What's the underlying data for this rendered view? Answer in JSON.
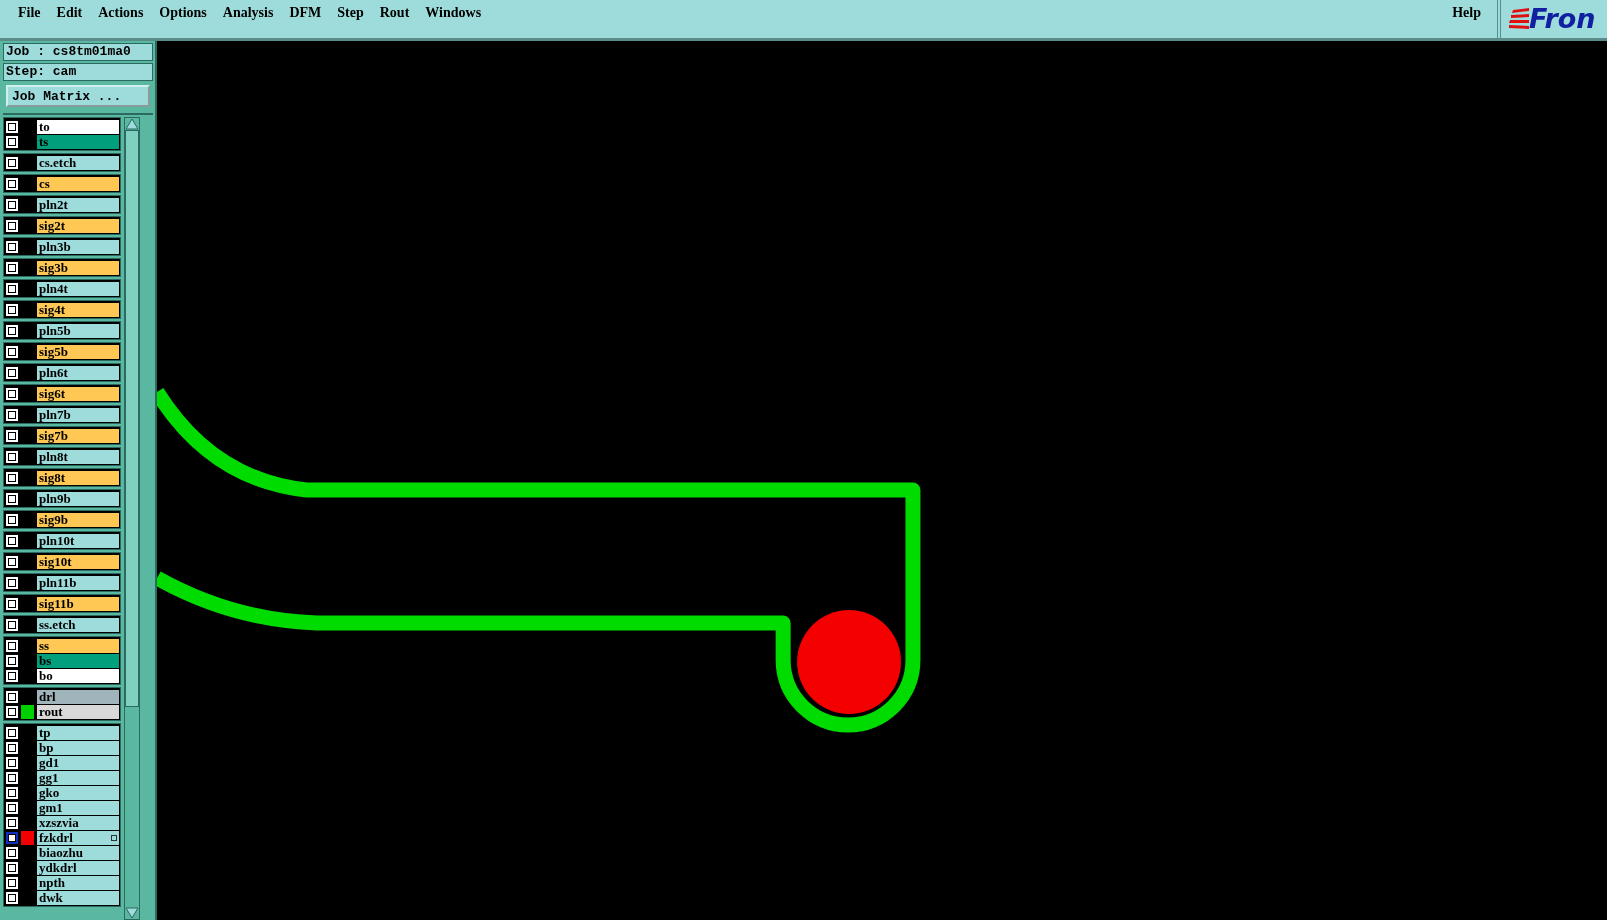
{
  "menu": [
    "File",
    "Edit",
    "Actions",
    "Options",
    "Analysis",
    "DFM",
    "Step",
    "Rout",
    "Windows"
  ],
  "help": "Help",
  "logo": "Fron",
  "job": "Job : cs8tm01ma0",
  "step": "Step: cam",
  "job_matrix_button": "Job Matrix ...",
  "layer_groups": [
    [
      {
        "name": "to",
        "color": "#ffffff",
        "selected": false
      },
      {
        "name": "ts",
        "color": "#00a07c",
        "selected": false
      }
    ],
    [
      {
        "name": "cs.etch",
        "color": "#9edcdc",
        "selected": false
      }
    ],
    [
      {
        "name": "cs",
        "color": "#ffc854",
        "selected": false
      }
    ],
    [
      {
        "name": "pln2t",
        "color": "#9edcdc",
        "selected": false
      }
    ],
    [
      {
        "name": "sig2t",
        "color": "#ffc854",
        "selected": false
      }
    ],
    [
      {
        "name": "pln3b",
        "color": "#9edcdc",
        "selected": false
      }
    ],
    [
      {
        "name": "sig3b",
        "color": "#ffc854",
        "selected": false
      }
    ],
    [
      {
        "name": "pln4t",
        "color": "#9edcdc",
        "selected": false
      }
    ],
    [
      {
        "name": "sig4t",
        "color": "#ffc854",
        "selected": false
      }
    ],
    [
      {
        "name": "pln5b",
        "color": "#9edcdc",
        "selected": false
      }
    ],
    [
      {
        "name": "sig5b",
        "color": "#ffc854",
        "selected": false
      }
    ],
    [
      {
        "name": "pln6t",
        "color": "#9edcdc",
        "selected": false
      }
    ],
    [
      {
        "name": "sig6t",
        "color": "#ffc854",
        "selected": false
      }
    ],
    [
      {
        "name": "pln7b",
        "color": "#9edcdc",
        "selected": false
      }
    ],
    [
      {
        "name": "sig7b",
        "color": "#ffc854",
        "selected": false
      }
    ],
    [
      {
        "name": "pln8t",
        "color": "#9edcdc",
        "selected": false
      }
    ],
    [
      {
        "name": "sig8t",
        "color": "#ffc854",
        "selected": false
      }
    ],
    [
      {
        "name": "pln9b",
        "color": "#9edcdc",
        "selected": false
      }
    ],
    [
      {
        "name": "sig9b",
        "color": "#ffc854",
        "selected": false
      }
    ],
    [
      {
        "name": "pln10t",
        "color": "#9edcdc",
        "selected": false
      }
    ],
    [
      {
        "name": "sig10t",
        "color": "#ffc854",
        "selected": false
      }
    ],
    [
      {
        "name": "pln11b",
        "color": "#9edcdc",
        "selected": false
      }
    ],
    [
      {
        "name": "sig11b",
        "color": "#ffc854",
        "selected": false
      }
    ],
    [
      {
        "name": "ss.etch",
        "color": "#9edcdc",
        "selected": false
      }
    ],
    [
      {
        "name": "ss",
        "color": "#ffc854",
        "selected": false
      },
      {
        "name": "bs",
        "color": "#00a07c",
        "selected": false
      },
      {
        "name": "bo",
        "color": "#ffffff",
        "selected": false
      }
    ],
    [
      {
        "name": "drl",
        "color": "#a0b4bc",
        "selected": false
      },
      {
        "name": "rout",
        "color": "#d8d8d8",
        "selected": false,
        "swatch": {
          "color": "#00d000"
        }
      }
    ],
    [
      {
        "name": "tp",
        "color": "#9edcdc",
        "selected": false
      },
      {
        "name": "bp",
        "color": "#9edcdc",
        "selected": false
      },
      {
        "name": "gd1",
        "color": "#9edcdc",
        "selected": false
      },
      {
        "name": "gg1",
        "color": "#9edcdc",
        "selected": false
      },
      {
        "name": "gko",
        "color": "#9edcdc",
        "selected": false
      },
      {
        "name": "gm1",
        "color": "#9edcdc",
        "selected": false
      },
      {
        "name": "xzszvia",
        "color": "#9edcdc",
        "selected": false
      },
      {
        "name": "fzkdrl",
        "color": "#9edcdc",
        "selected": true,
        "swatch": {
          "color": "#f00000"
        }
      },
      {
        "name": "biaozhu",
        "color": "#9edcdc",
        "selected": false
      },
      {
        "name": "ydkdrl",
        "color": "#9edcdc",
        "selected": false
      },
      {
        "name": "npth",
        "color": "#9edcdc",
        "selected": false
      },
      {
        "name": "dwk",
        "color": "#9edcdc",
        "selected": false
      }
    ]
  ]
}
